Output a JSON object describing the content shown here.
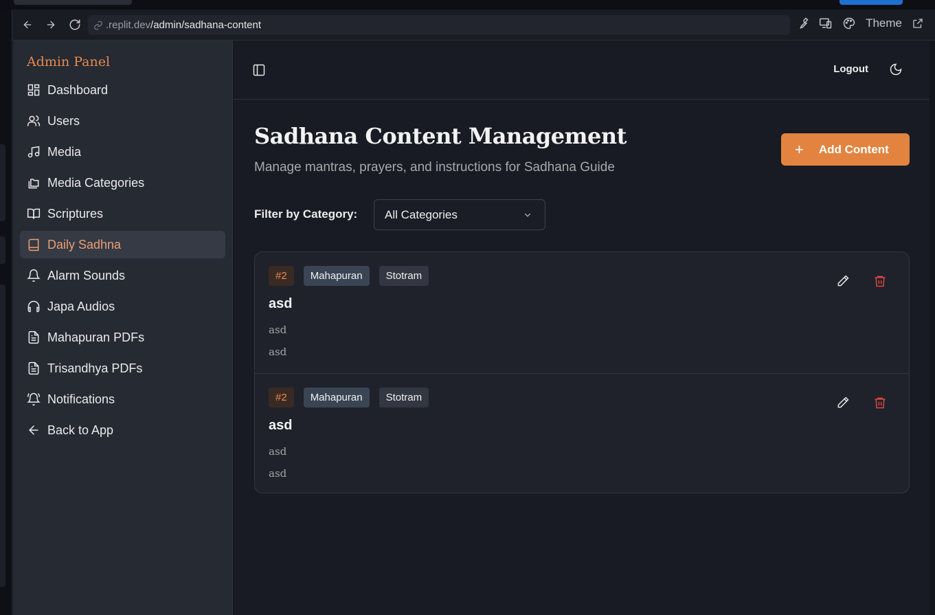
{
  "browser": {
    "url_domain": ".replit.dev",
    "url_path": "/admin/sadhana-content",
    "theme_label": "Theme"
  },
  "sidebar": {
    "brand": "Admin Panel",
    "items": [
      {
        "label": "Dashboard",
        "icon": "dashboard-icon"
      },
      {
        "label": "Users",
        "icon": "users-icon"
      },
      {
        "label": "Media",
        "icon": "music-note-icon"
      },
      {
        "label": "Media Categories",
        "icon": "folders-icon"
      },
      {
        "label": "Scriptures",
        "icon": "book-open-icon"
      },
      {
        "label": "Daily Sadhna",
        "icon": "book-icon",
        "active": true
      },
      {
        "label": "Alarm Sounds",
        "icon": "bell-icon"
      },
      {
        "label": "Japa Audios",
        "icon": "headphones-icon"
      },
      {
        "label": "Mahapuran PDFs",
        "icon": "file-text-icon"
      },
      {
        "label": "Trisandhya PDFs",
        "icon": "file-text-icon"
      },
      {
        "label": "Notifications",
        "icon": "bell-ring-icon"
      },
      {
        "label": "Back to App",
        "icon": "arrow-left-icon"
      }
    ]
  },
  "header": {
    "logout_label": "Logout"
  },
  "page": {
    "title": "Sadhana Content Management",
    "subtitle": "Manage mantras, prayers, and instructions for Sadhana Guide",
    "add_button_label": "Add Content",
    "filter_label": "Filter by Category:",
    "filter_value": "All Categories"
  },
  "content_items": [
    {
      "order": "#2",
      "category": "Mahapuran",
      "type": "Stotram",
      "title": "asd",
      "line1": "asd",
      "line2": "asd"
    },
    {
      "order": "#2",
      "category": "Mahapuran",
      "type": "Stotram",
      "title": "asd",
      "line1": "asd",
      "line2": "asd"
    }
  ],
  "colors": {
    "accent": "#e2843f",
    "delete": "#e04545",
    "sidebar_bg": "#262a33",
    "main_bg": "#181b23"
  }
}
